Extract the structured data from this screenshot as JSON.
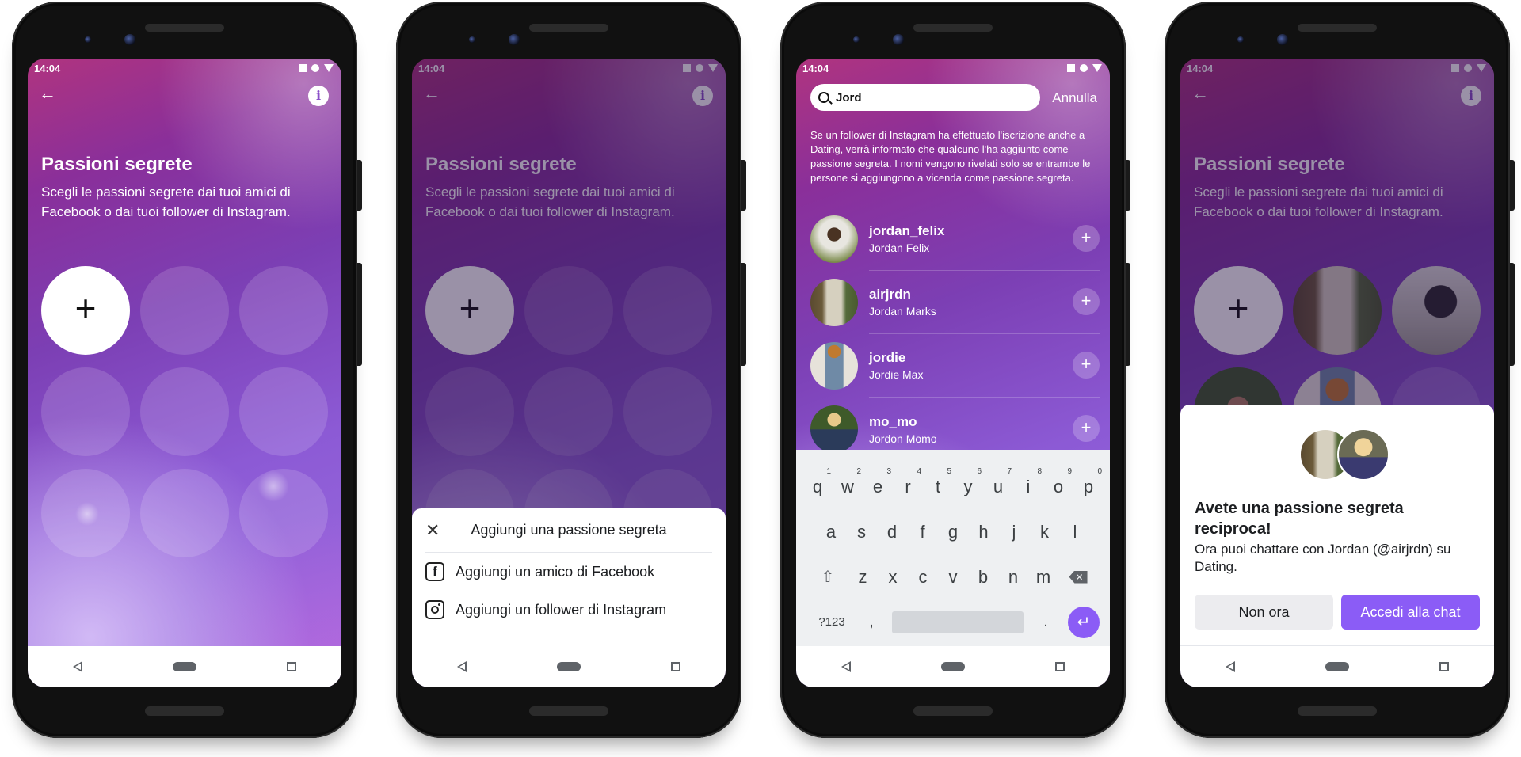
{
  "status_time": "14:04",
  "colors": {
    "accent": "#8b5cf6",
    "bg_purple": "#7c3fb4"
  },
  "intro_screen": {
    "back_icon": "arrow-left-icon",
    "info_icon": "info-icon",
    "title": "Passioni segrete",
    "subtitle": "Scegli le passioni segrete dai tuoi amici di Facebook o dai tuoi follower di Instagram.",
    "add_label": "+"
  },
  "add_sheet": {
    "close_icon": "close-icon",
    "title": "Aggiungi una passione segreta",
    "options": [
      {
        "icon": "facebook-icon",
        "glyph": "f",
        "label": "Aggiungi un amico di Facebook"
      },
      {
        "icon": "instagram-icon",
        "glyph": "",
        "label": "Aggiungi un follower di Instagram"
      }
    ]
  },
  "search_screen": {
    "search_value": "Jord",
    "cancel_label": "Annulla",
    "info_text": "Se un follower di Instagram ha effettuato l'iscrizione anche a Dating, verrà informato che qualcuno l'ha aggiunto come passione segreta. I nomi vengono rivelati solo se entrambe le persone si aggiungono a vicenda come passione segreta.",
    "results": [
      {
        "username": "jordan_felix",
        "name": "Jordan Felix"
      },
      {
        "username": "airjrdn",
        "name": "Jordan Marks"
      },
      {
        "username": "jordie",
        "name": "Jordie Max"
      },
      {
        "username": "mo_mo",
        "name": "Jordon Momo"
      }
    ],
    "add_label": "+"
  },
  "keyboard": {
    "row1": [
      "q",
      "w",
      "e",
      "r",
      "t",
      "y",
      "u",
      "i",
      "o",
      "p"
    ],
    "row1_hints": [
      "1",
      "2",
      "3",
      "4",
      "5",
      "6",
      "7",
      "8",
      "9",
      "0"
    ],
    "row2": [
      "a",
      "s",
      "d",
      "f",
      "g",
      "h",
      "j",
      "k",
      "l"
    ],
    "row3": [
      "z",
      "x",
      "c",
      "v",
      "b",
      "n",
      "m"
    ],
    "shift": "⇧",
    "backspace": "✕",
    "symbols": "?123",
    "comma": ",",
    "period": ".",
    "enter": "↵"
  },
  "match_screen": {
    "title": "Avete una passione segreta reciproca!",
    "text": "Ora puoi chattare con Jordan (@airjrdn) su Dating.",
    "secondary_button": "Non ora",
    "primary_button": "Accedi alla chat"
  }
}
